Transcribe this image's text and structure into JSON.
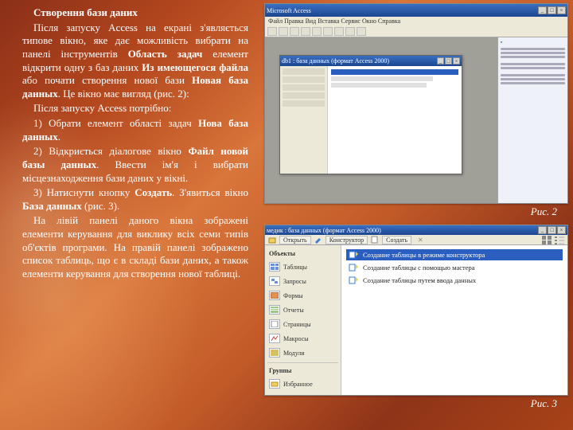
{
  "text": {
    "title": "Створення бази даних",
    "p1a": "Після запуску Access на екрані з'являється типове вікно, яке дає можливість вибрати на панелі інструментів ",
    "p1b": "Область задач",
    "p1c": " елемент відкрити одну з баз даних ",
    "p1d": "Из имеющегося файла",
    "p1e": " або почати створення нової бази ",
    "p1f": "Новая база данных",
    "p1g": ". Це вікно має вигляд (рис. 2):",
    "p2": "Після запуску Access потрібно:",
    "p3a": "1) Обрати елемент області задач ",
    "p3b": "Нова база данных",
    "p3c": ".",
    "p4a": "2) Відкриється діалогове вікно ",
    "p4b": "Файл новой базы данных",
    "p4c": ". Ввести ім'я і вибрати місцезнаходження бази даних у вікні.",
    "p5a": "3) Натиснути кнопку ",
    "p5b": "Создать",
    "p5c": ". З'явиться вікно ",
    "p5d": "База данных",
    "p5e": " (рис. 3).",
    "p6": "На лівій панелі даного вікна зображені елементи керування для виклику всіх семи типів об'єктів програми. На правій панелі зображено список таблиць, що є в складі бази даних, а також елементи керування для створення нової таблиці."
  },
  "captions": {
    "fig2": "Рис. 2",
    "fig3": "Рис. 3"
  },
  "fig1": {
    "title": "Microsoft Access",
    "menu": "Файл  Правка  Вид  Вставка  Сервис  Окно  Справка",
    "subtitle": "db1 : база данных (формат Access 2000)"
  },
  "fig2": {
    "title": "медик : база данных (формат Access 2000)",
    "toolbar": {
      "open": "Открыть",
      "design": "Конструктор",
      "new": "Создать"
    },
    "cats": [
      "Объекты",
      "Таблицы",
      "Запросы",
      "Формы",
      "Отчеты",
      "Страницы",
      "Макросы",
      "Модули",
      "Группы",
      "Избранное"
    ],
    "items": [
      "Создание таблицы в режиме конструктора",
      "Создание таблицы с помощью мастера",
      "Создание таблицы путем ввода данных"
    ]
  }
}
